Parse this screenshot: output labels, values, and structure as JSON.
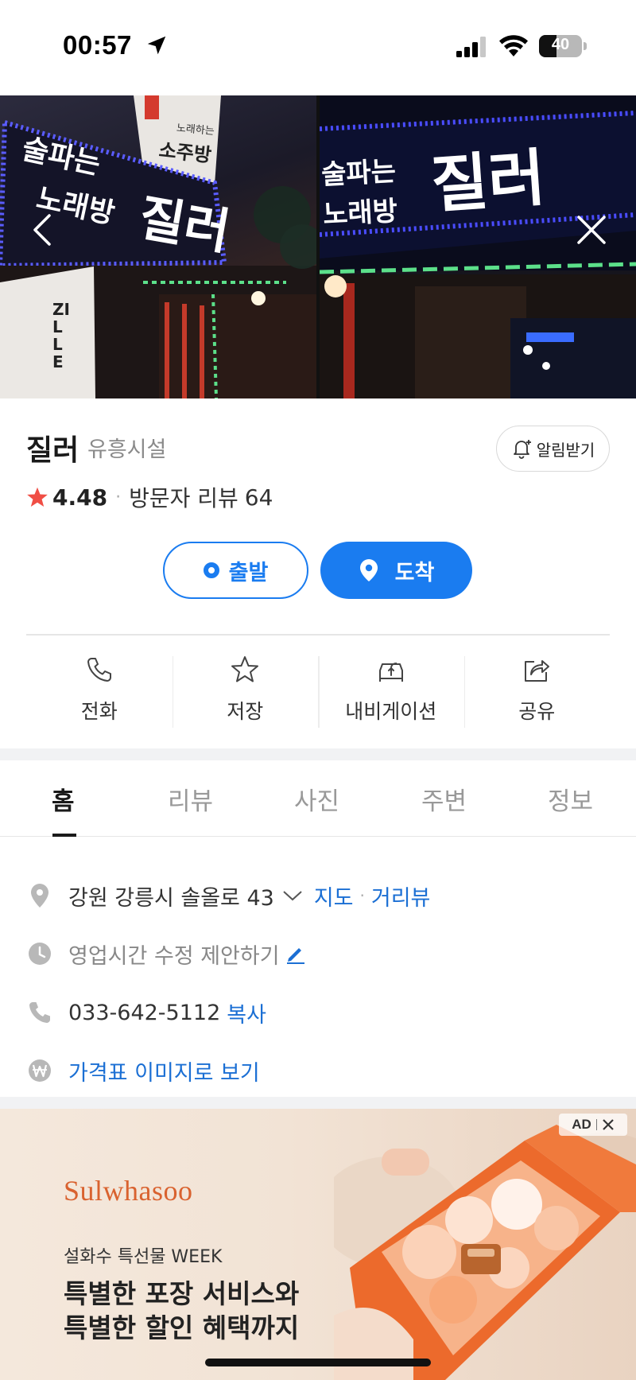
{
  "status_bar": {
    "time": "00:57",
    "battery": 40,
    "icons": [
      "location-arrow-icon",
      "cellular-signal-icon",
      "wifi-icon",
      "battery-icon"
    ]
  },
  "photos": {
    "sign_1_small": "노래하는",
    "sign_1_room": "소주방",
    "sign_1_line1": "술파는",
    "sign_1_line2": "노래방",
    "sign_1_brand": "질러",
    "sign_1_vertical": "ZILLE",
    "sign_2_line1": "술파는",
    "sign_2_line2": "노래방",
    "sign_2_brand": "질러",
    "icons": [
      "chevron-left-icon",
      "close-icon"
    ]
  },
  "place": {
    "name": "질러",
    "category": "유흥시설",
    "alarm_label": "알림받기",
    "rating": "4.48",
    "review_label": "방문자 리뷰",
    "review_count": "64",
    "colors": {
      "accent": "#1a7cf0",
      "star": "#f04e45"
    }
  },
  "route": {
    "start_label": "출발",
    "end_label": "도착"
  },
  "actions": [
    {
      "label": "전화",
      "icon": "phone-icon"
    },
    {
      "label": "저장",
      "icon": "star-icon"
    },
    {
      "label": "내비게이션",
      "icon": "navigation-car-icon"
    },
    {
      "label": "공유",
      "icon": "share-icon"
    }
  ],
  "tabs": [
    {
      "label": "홈",
      "active": true
    },
    {
      "label": "리뷰",
      "active": false
    },
    {
      "label": "사진",
      "active": false
    },
    {
      "label": "주변",
      "active": false
    },
    {
      "label": "정보",
      "active": false
    }
  ],
  "info": {
    "address": "강원 강릉시 솔올로 43",
    "map_link": "지도",
    "street_view_link": "거리뷰",
    "hours_suggest": "영업시간 수정 제안하기",
    "phone": "033-642-5112",
    "copy_link": "복사",
    "price_link": "가격표 이미지로 보기"
  },
  "ad": {
    "badge": "AD",
    "brand": "Sulwhasoo",
    "subtitle": "설화수 특선물 WEEK",
    "headline_1": "특별한 포장 서비스와",
    "headline_2": "특별한 할인 혜택까지",
    "colors": {
      "brand": "#d9622f",
      "box": "#ec6a2c"
    }
  }
}
